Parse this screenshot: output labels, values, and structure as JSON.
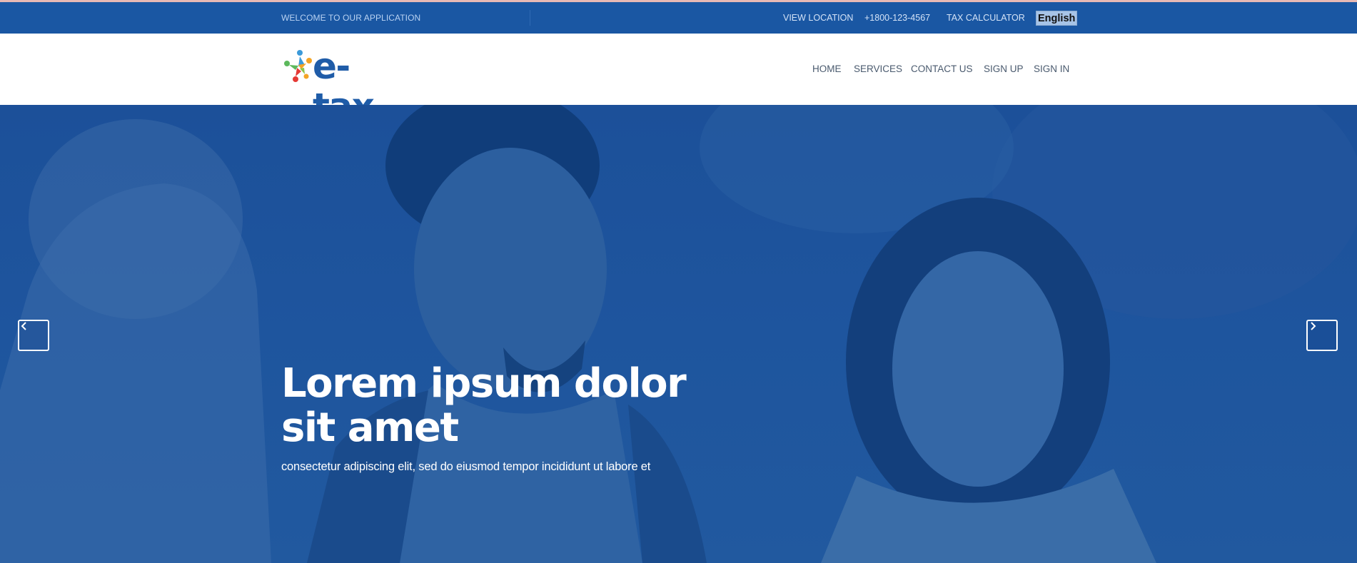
{
  "topbar": {
    "welcome": "WELCOME TO OUR APPLICATION",
    "links": [
      "VIEW LOCATION",
      "+1800-123-4567",
      "TAX CALCULATOR"
    ],
    "language": "English"
  },
  "brand": {
    "name": "e-tax",
    "colors": [
      "#1f5ca8",
      "#e53935",
      "#f4a425",
      "#5cb85c",
      "#3b9ad9"
    ]
  },
  "nav": {
    "items": [
      "HOME",
      "SERVICES",
      "CONTACT US",
      "SIGN UP",
      "SIGN IN"
    ]
  },
  "hero": {
    "title": "Lorem ipsum dolor sit amet",
    "subtitle": "consectetur adipiscing elit, sed do eiusmod tempor incididunt ut labore et",
    "prev_icon": "chevron-left-icon",
    "next_icon": "chevron-right-icon",
    "overlay_color": "#1c5099"
  }
}
